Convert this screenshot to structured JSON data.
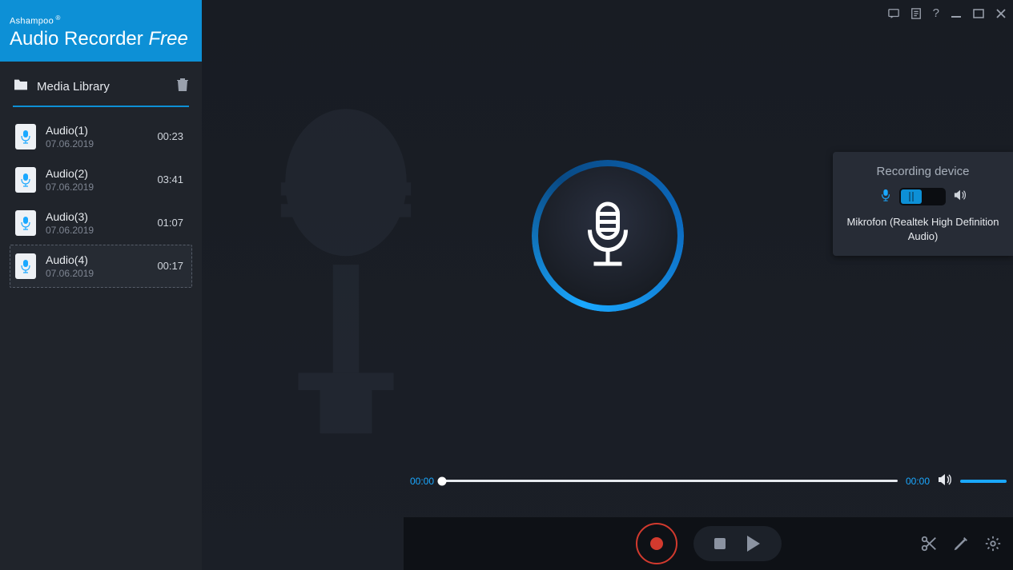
{
  "brand": {
    "company": "Ashampoo",
    "title_main": "Audio Recorder ",
    "title_italic": "Free"
  },
  "library": {
    "header": "Media Library",
    "tracks": [
      {
        "name": "Audio(1)",
        "date": "07.06.2019",
        "duration": "00:23",
        "selected": false
      },
      {
        "name": "Audio(2)",
        "date": "07.06.2019",
        "duration": "03:41",
        "selected": false
      },
      {
        "name": "Audio(3)",
        "date": "07.06.2019",
        "duration": "01:07",
        "selected": false
      },
      {
        "name": "Audio(4)",
        "date": "07.06.2019",
        "duration": "00:17",
        "selected": true
      }
    ]
  },
  "playback": {
    "current_time": "00:00",
    "total_time": "00:00"
  },
  "device_panel": {
    "title": "Recording device",
    "selected": "mic",
    "device_name": "Mikrofon (Realtek High Definition Audio)"
  },
  "window_controls": {
    "help": "?"
  },
  "icons": {
    "folder": "folder-icon",
    "trash": "trash-icon"
  }
}
